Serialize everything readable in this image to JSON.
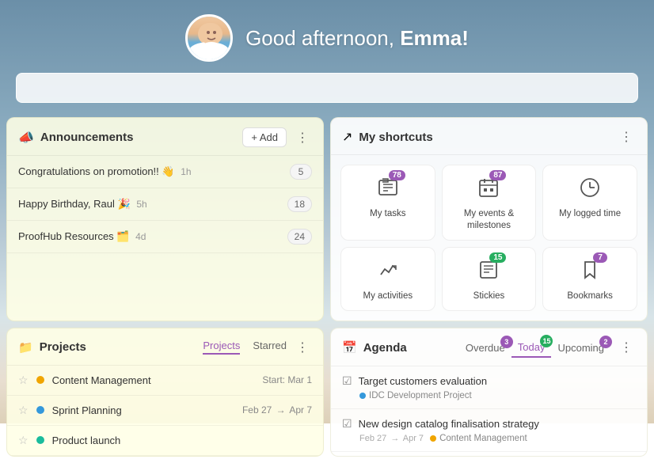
{
  "header": {
    "greeting": "Good afternoon, ",
    "name": "Emma!",
    "avatar_alt": "Emma avatar"
  },
  "search": {
    "placeholder": ""
  },
  "announcements": {
    "title": "Announcements",
    "add_label": "+ Add",
    "items": [
      {
        "text": "Congratulations on promotion!! 👋",
        "time": "1h",
        "count": "5"
      },
      {
        "text": "Happy Birthday, Raul 🎉",
        "time": "5h",
        "count": "18"
      },
      {
        "text": "ProofHub Resources 🗂️",
        "time": "4d",
        "count": "24"
      }
    ]
  },
  "shortcuts": {
    "title": "My shortcuts",
    "items": [
      {
        "label": "My tasks",
        "icon": "✓",
        "badge": "78",
        "badge_color": "purple"
      },
      {
        "label": "My events & milestones",
        "icon": "📅",
        "badge": "87",
        "badge_color": "purple"
      },
      {
        "label": "My logged time",
        "icon": "⏰",
        "badge": null
      },
      {
        "label": "My activities",
        "icon": "✓",
        "badge": null
      },
      {
        "label": "Stickies",
        "icon": "📋",
        "badge": "15",
        "badge_color": "green"
      },
      {
        "label": "Bookmarks",
        "icon": "🔖",
        "badge": "7",
        "badge_color": "purple"
      }
    ]
  },
  "projects": {
    "title": "Projects",
    "tabs": [
      "Projects",
      "Starred"
    ],
    "active_tab": "Projects",
    "items": [
      {
        "name": "Content Management",
        "color": "#f0a500",
        "date": "Start: Mar 1",
        "starred": false
      },
      {
        "name": "Sprint Planning",
        "color": "#3498db",
        "date": "Feb 27 → Apr 7",
        "starred": false
      },
      {
        "name": "Product launch",
        "color": "#1abc9c",
        "date": "",
        "starred": false
      }
    ]
  },
  "agenda": {
    "title": "Agenda",
    "tabs": [
      {
        "label": "Overdue",
        "badge": "3",
        "badge_color": "purple"
      },
      {
        "label": "Today",
        "badge": "15",
        "badge_color": "green"
      },
      {
        "label": "Upcoming",
        "badge": "2",
        "badge_color": "purple"
      }
    ],
    "active_tab": "Today",
    "items": [
      {
        "title": "Target customers evaluation",
        "project": "IDC Development Project",
        "project_color": "#3498db",
        "date": null
      },
      {
        "title": "New design catalog finalisation strategy",
        "project": "Content Management",
        "project_color": "#f0a500",
        "date": "Feb 27 → Apr 7"
      }
    ]
  },
  "colors": {
    "purple": "#9b59b6",
    "green": "#27ae60",
    "yellow_bg": "rgba(255,255,230,0.88)"
  }
}
